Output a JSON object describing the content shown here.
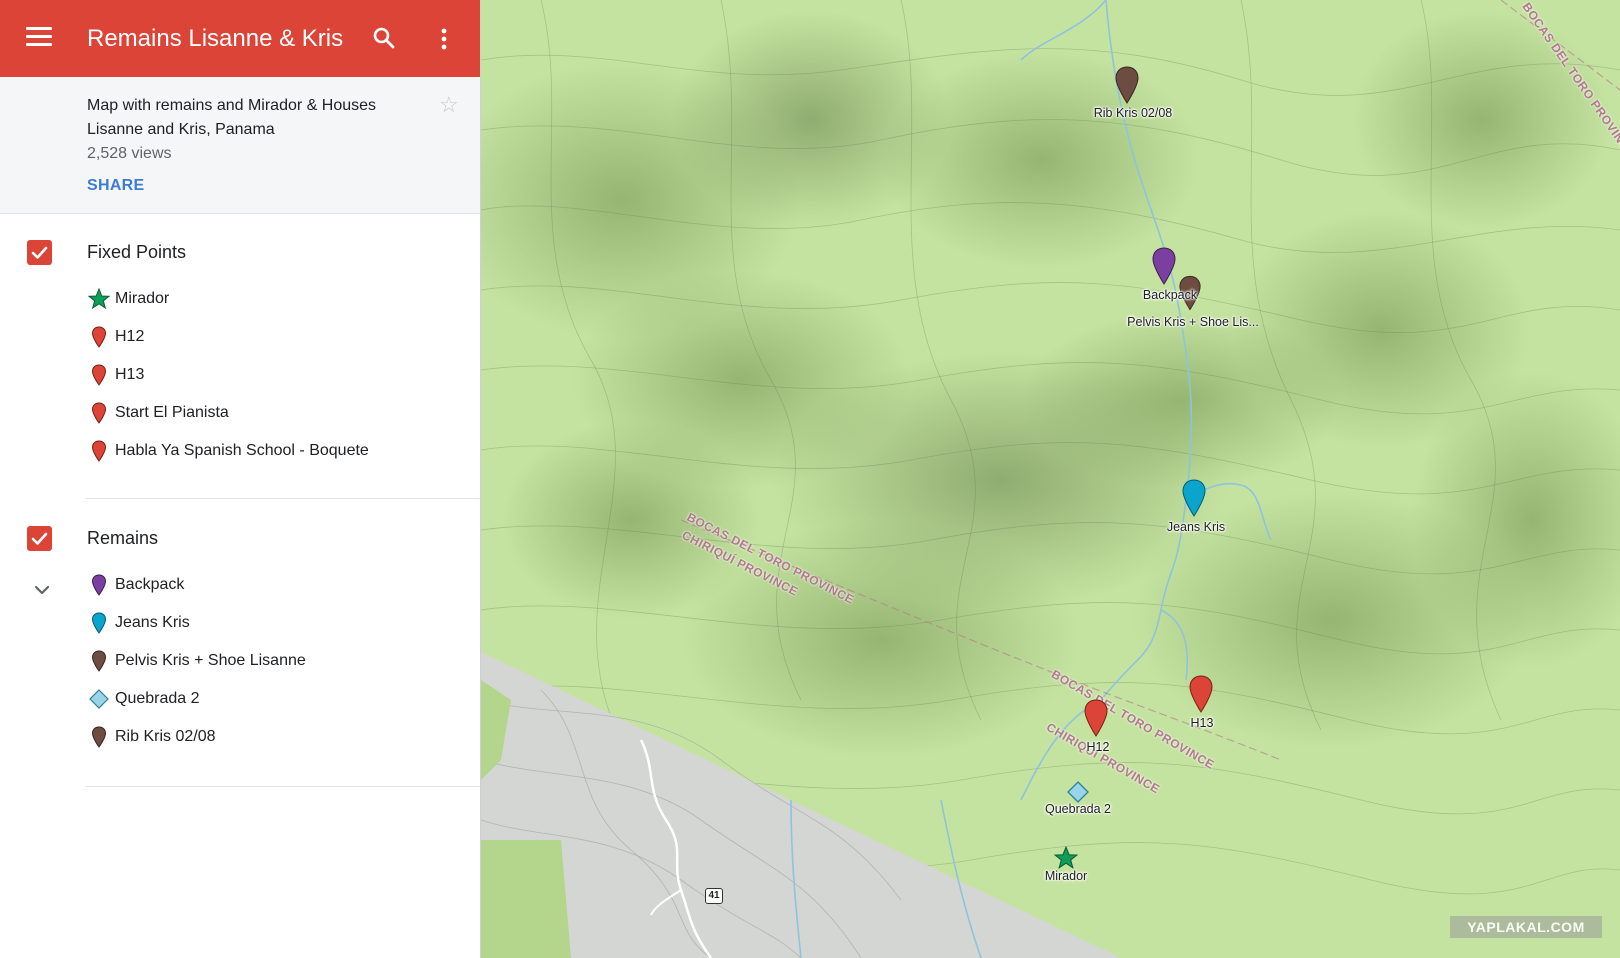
{
  "app": {
    "title": "Remains Lisanne & Kris",
    "menu_icon": "menu-icon",
    "search_icon": "search-icon",
    "more_icon": "more-vert-icon",
    "accent_color": "#db4437"
  },
  "info": {
    "description": "Map with remains and Mirador & Houses Lisanne and Kris, Panama",
    "views": "2,528 views",
    "share_label": "SHARE",
    "star_icon": "star-outline-icon"
  },
  "layers": [
    {
      "title": "Fixed Points",
      "checked": true,
      "items": [
        {
          "label": "Mirador",
          "icon": "star-icon",
          "color": "#0f9d58"
        },
        {
          "label": "H12",
          "icon": "pin-icon",
          "color": "#db4437"
        },
        {
          "label": "H13",
          "icon": "pin-icon",
          "color": "#db4437"
        },
        {
          "label": "Start El Pianista",
          "icon": "pin-icon",
          "color": "#db4437"
        },
        {
          "label": "Habla Ya Spanish School - Boquete",
          "icon": "pin-icon",
          "color": "#db4437"
        }
      ]
    },
    {
      "title": "Remains",
      "checked": true,
      "items": [
        {
          "label": "Backpack",
          "icon": "pin-icon",
          "color": "#7b3fa0"
        },
        {
          "label": "Jeans Kris",
          "icon": "pin-icon",
          "color": "#0aa4cc"
        },
        {
          "label": "Pelvis Kris + Shoe Lisanne",
          "icon": "pin-icon",
          "color": "#6d4c41"
        },
        {
          "label": "Quebrada 2",
          "icon": "diamond-icon",
          "color": "#9ad4e8"
        },
        {
          "label": "Rib Kris 02/08",
          "icon": "pin-icon",
          "color": "#6d4c41"
        }
      ]
    }
  ],
  "map": {
    "markers": [
      {
        "label": "Rib Kris 02/08",
        "icon": "pin-icon",
        "color": "#6d4c41"
      },
      {
        "label": "Backpack",
        "icon": "pin-icon",
        "color": "#7b3fa0"
      },
      {
        "label": "Pelvis Kris + Shoe Lis...",
        "icon": "pin-icon",
        "color": "#6d4c41"
      },
      {
        "label": "Jeans Kris",
        "icon": "pin-icon",
        "color": "#0aa4cc"
      },
      {
        "label": "H13",
        "icon": "pin-icon",
        "color": "#db4437"
      },
      {
        "label": "H12",
        "icon": "pin-icon",
        "color": "#db4437"
      },
      {
        "label": "Quebrada 2",
        "icon": "diamond-icon",
        "color": "#9ad4e8"
      },
      {
        "label": "Mirador",
        "icon": "star-icon",
        "color": "#0f9d58"
      }
    ],
    "province_labels": [
      {
        "text": "BOCAS DEL TORO PROVINCE"
      },
      {
        "text": "CHIRIQUÍ PROVINCE"
      },
      {
        "text": "BOCAS DEL TORO PROVINCE"
      },
      {
        "text": "CHIRIQUÍ PROVINCE"
      },
      {
        "text": "BOCAS DEL TORO PROVINCE"
      }
    ],
    "route_shield": "41",
    "watermark": "YAPLAKAL.COM",
    "terrain_color": "#c5e3a0",
    "province_border_color": "#b07a86"
  }
}
